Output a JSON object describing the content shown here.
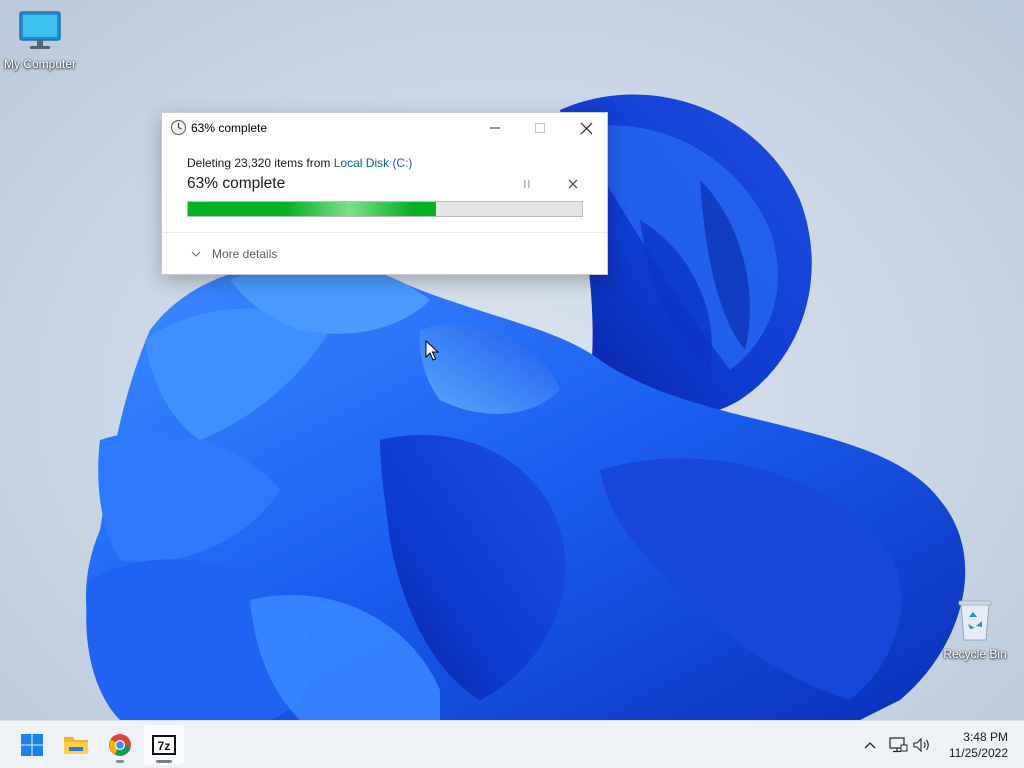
{
  "desktop": {
    "icons": [
      {
        "label": "My Computer"
      },
      {
        "label": "Recycle Bin"
      }
    ]
  },
  "dialog": {
    "title": "63% complete",
    "description_prefix": "Deleting 23,320 items from ",
    "location_link": "Local Disk (C:)",
    "status": "63% complete",
    "progress": 0.63,
    "details_label": "More details"
  },
  "taskbar": {
    "apps": [
      "start-icon",
      "file-explorer-icon",
      "chrome-icon",
      "7zip-icon"
    ],
    "tray": [
      "chevron-up-icon",
      "network-icon",
      "volume-icon"
    ],
    "time": "3:48 PM",
    "date": "11/25/2022"
  },
  "colors": {
    "progress_fill": "#06b025",
    "link": "#0b5cad",
    "taskbar_bg": "#eef1f6"
  }
}
